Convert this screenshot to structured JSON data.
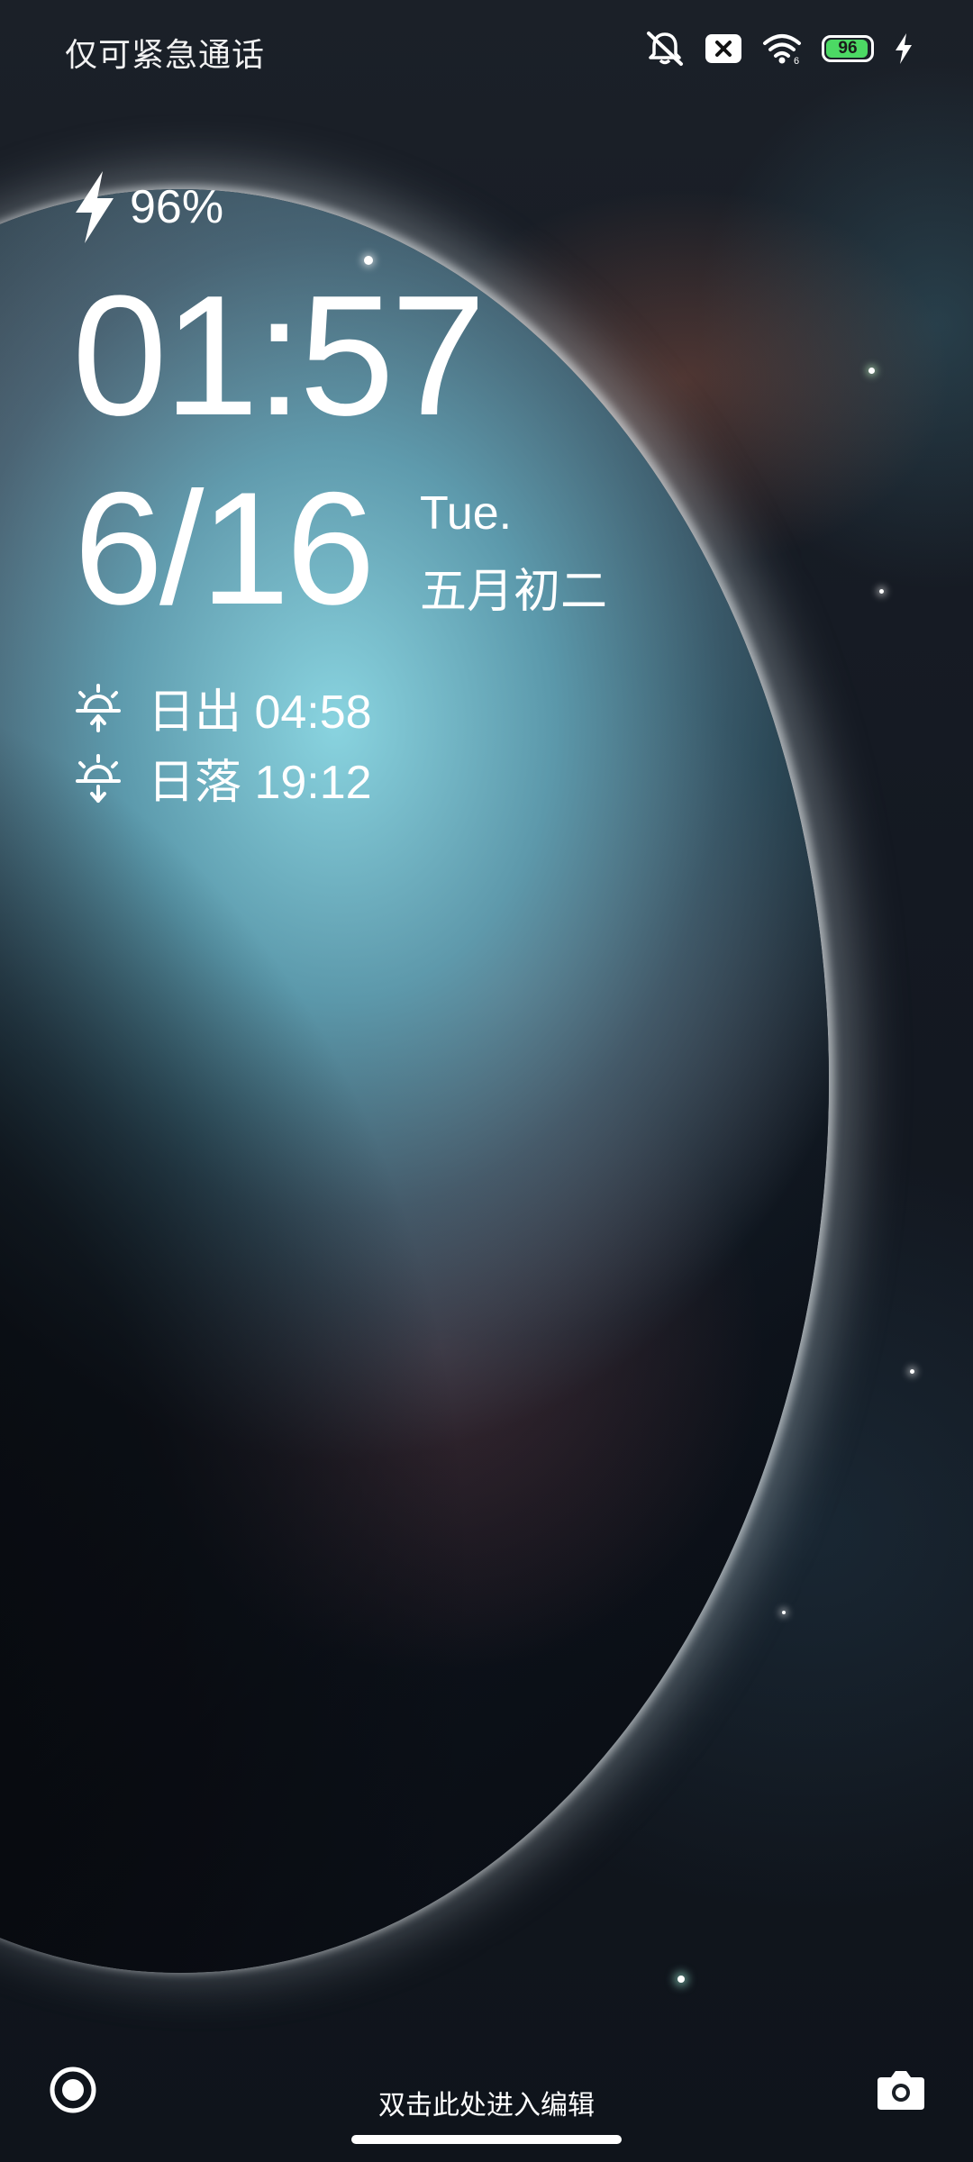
{
  "status_bar": {
    "carrier_text": "仅可紧急通话",
    "icons": [
      "mute-icon",
      "sim-error-icon",
      "wifi-icon",
      "battery-icon",
      "charging-bolt-icon"
    ],
    "battery_level": "96",
    "battery_fraction": 0.96
  },
  "lockscreen": {
    "charge_icon": "lightning-bolt-icon",
    "charge_percent": "96%",
    "time": "01:57",
    "date": "6/16",
    "weekday": "Tue.",
    "lunar_date": "五月初二",
    "sunrise": "日出 04:58",
    "sunset": "日落 19:12"
  },
  "bottom": {
    "left_button_icon": "record-icon",
    "edit_hint": "双击此处进入编辑",
    "right_button_icon": "camera-icon"
  },
  "colors": {
    "battery_fill": "#4cd964",
    "text": "#ffffff"
  }
}
